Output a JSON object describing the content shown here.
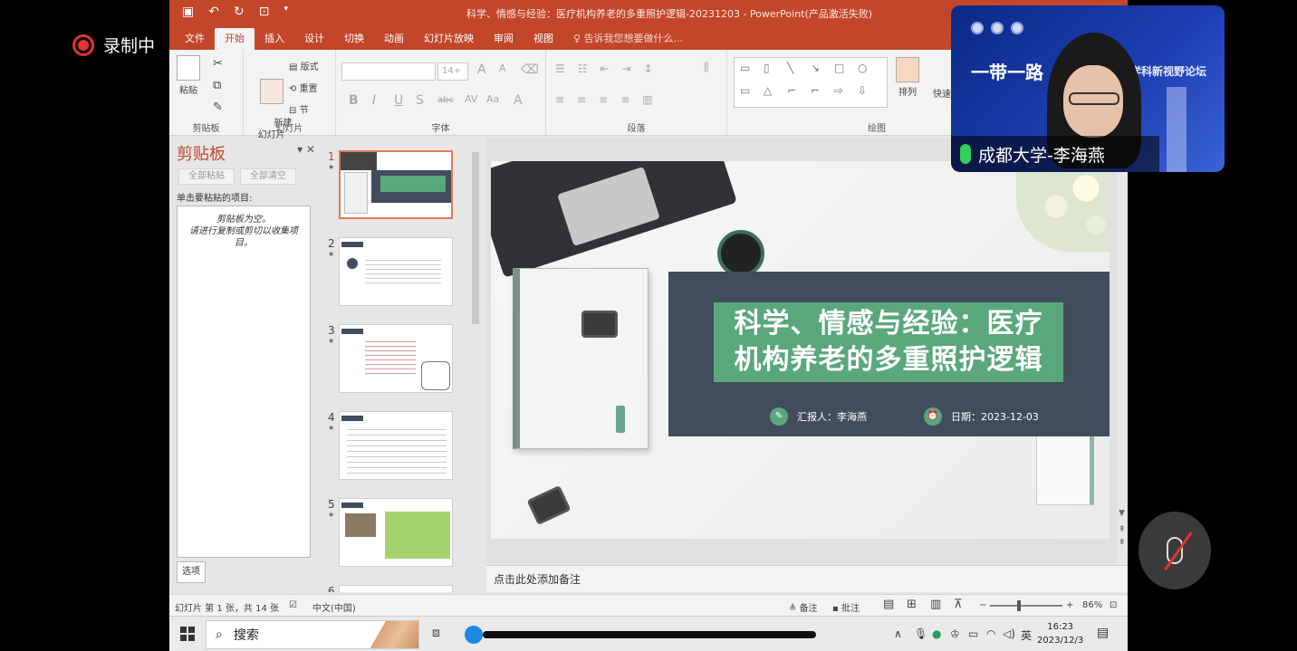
{
  "recording": {
    "label": "录制中"
  },
  "window": {
    "title": "科学、情感与经验：医疗机构养老的多重照护逻辑-20231203 - PowerPoint(产品激活失败)"
  },
  "tabs": [
    "文件",
    "开始",
    "插入",
    "设计",
    "切换",
    "动画",
    "幻灯片放映",
    "审阅",
    "视图"
  ],
  "tell_me": "告诉我您想要做什么...",
  "ribbon": {
    "clipboard": {
      "paste": "粘贴",
      "label": "剪贴板"
    },
    "slides": {
      "new_slide": "新建\n幻灯片",
      "layout": "版式",
      "reset": "重置",
      "section": "节",
      "label": "幻灯片"
    },
    "font": {
      "size": "14+",
      "label": "字体"
    },
    "paragraph": {
      "label": "段落"
    },
    "drawing": {
      "arrange": "排列",
      "quick_styles": "快速样",
      "label": "绘图"
    }
  },
  "clipboard_pane": {
    "title": "剪贴板",
    "paste_all": "全部粘贴",
    "clear_all": "全部清空",
    "hint": "单击要粘贴的项目:",
    "empty_msg_1": "剪贴板为空。",
    "empty_msg_2": "请进行复制或剪切以收集项",
    "empty_msg_3": "目。",
    "options": "选项"
  },
  "thumbnails": [
    {
      "num": "1",
      "active": true
    },
    {
      "num": "2",
      "active": false
    },
    {
      "num": "3",
      "active": false
    },
    {
      "num": "4",
      "active": false
    },
    {
      "num": "5",
      "active": false
    },
    {
      "num": "6",
      "active": false
    }
  ],
  "slide": {
    "title_line1": "科学、情感与经验：医疗",
    "title_line2": "机构养老的多重照护逻辑",
    "reporter": "汇报人：李海燕",
    "date": "日期：2023-12-03"
  },
  "notes": {
    "placeholder": "点击此处添加备注"
  },
  "status": {
    "slide_info": "幻灯片 第 1 张，共 14 张",
    "language": "中文(中国)",
    "notes_btn": "备注",
    "comments_btn": "批注",
    "zoom": "86%"
  },
  "taskbar": {
    "search": "搜索",
    "ime": "英",
    "time": "16:23",
    "date": "2023/12/3"
  },
  "video": {
    "banner": "一带一路",
    "banner2": "跨学科新视野论坛",
    "participant": "成都大学-李海燕"
  },
  "colors": {
    "ppt_accent": "#c4462a",
    "slide_banner": "#414c5c",
    "title_box": "#5aa77c"
  }
}
